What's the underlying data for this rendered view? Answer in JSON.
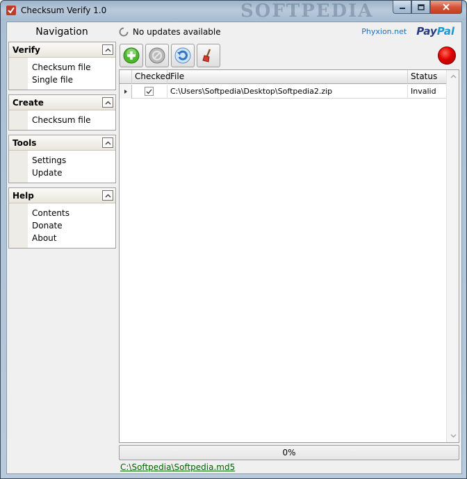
{
  "window": {
    "title": "Checksum Verify 1.0",
    "watermark": "SOFTPEDIA"
  },
  "nav": {
    "title": "Navigation",
    "groups": [
      {
        "title": "Verify",
        "items": [
          "Checksum file",
          "Single file"
        ]
      },
      {
        "title": "Create",
        "items": [
          "Checksum file"
        ]
      },
      {
        "title": "Tools",
        "items": [
          "Settings",
          "Update"
        ]
      },
      {
        "title": "Help",
        "items": [
          "Contents",
          "Donate",
          "About"
        ]
      }
    ]
  },
  "status": {
    "text": "No updates available"
  },
  "links": {
    "phyxion": "Phyxion.net",
    "paypal_pay": "Pay",
    "paypal_pal": "Pal"
  },
  "grid": {
    "columns": [
      "Checked",
      "File",
      "Status"
    ],
    "rows": [
      {
        "checked": true,
        "file": "C:\\Users\\Softpedia\\Desktop\\Softpedia2.zip",
        "status": "Invalid"
      }
    ]
  },
  "progress": {
    "label": "0%",
    "value": 0
  },
  "checksum_file": "C:\\Softpedia\\Softpedia.md5"
}
